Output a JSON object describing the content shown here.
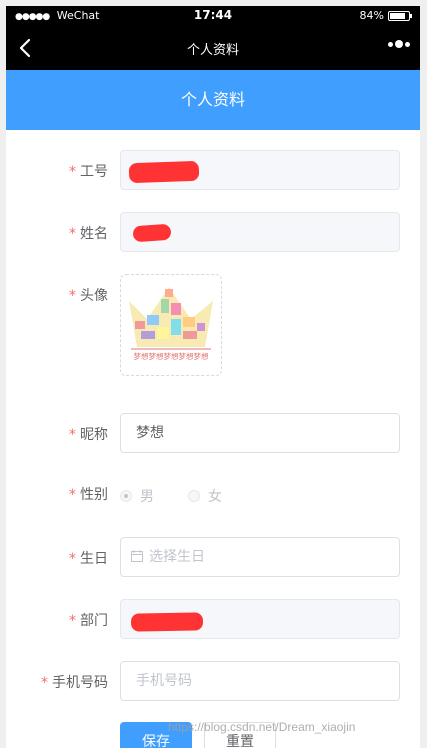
{
  "status_bar": {
    "signal": "●●●●●",
    "carrier": "WeChat",
    "time": "17:44",
    "battery": "84%",
    "battery_level": 0.84
  },
  "nav": {
    "title": "个人资料"
  },
  "header": {
    "title": "个人资料"
  },
  "form": {
    "required_mark": "*",
    "employee_id": {
      "label": "工号"
    },
    "name": {
      "label": "姓名"
    },
    "avatar": {
      "label": "头像",
      "image_text": [
        "梦想",
        "梦想",
        "梦想",
        "梦想",
        "梦想"
      ]
    },
    "nickname": {
      "label": "昵称",
      "value": "梦想"
    },
    "gender": {
      "label": "性别",
      "options": [
        "男",
        "女"
      ],
      "selected": "男"
    },
    "birthday": {
      "label": "生日",
      "placeholder": "选择生日"
    },
    "department": {
      "label": "部门"
    },
    "phone": {
      "label": "手机号码",
      "placeholder": "手机号码"
    }
  },
  "buttons": {
    "save": "保存",
    "reset": "重置"
  },
  "watermark": "https://blog.csdn.net/Dream_xiaojin",
  "colors": {
    "primary": "#409eff",
    "required": "#f56c6c",
    "redaction": "#ff3333"
  }
}
